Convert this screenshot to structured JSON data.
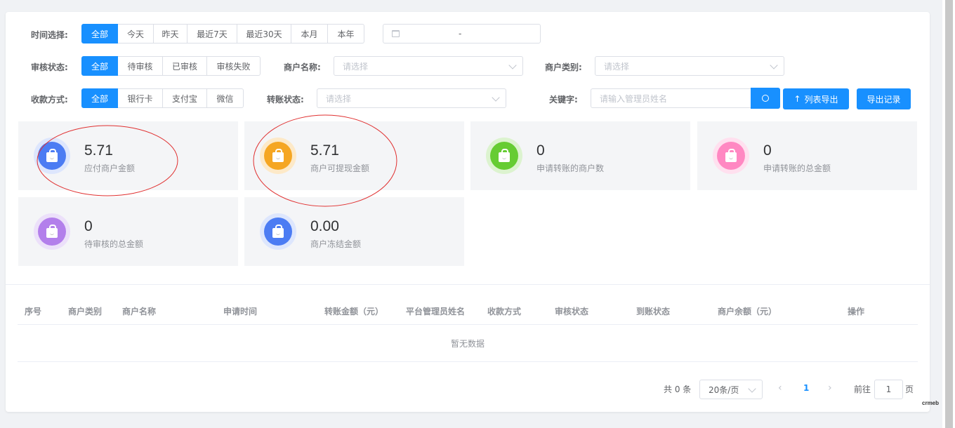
{
  "filters": {
    "time_label": "时间选择:",
    "time_options": [
      "全部",
      "今天",
      "昨天",
      "最近7天",
      "最近30天",
      "本月",
      "本年"
    ],
    "date_range_sep": "-",
    "audit_label": "审核状态:",
    "audit_options": [
      "全部",
      "待审核",
      "已审核",
      "审核失败"
    ],
    "merchant_name_label": "商户名称:",
    "merchant_name_placeholder": "请选择",
    "merchant_type_label": "商户类别:",
    "merchant_type_placeholder": "请选择",
    "pay_label": "收款方式:",
    "pay_options": [
      "全部",
      "银行卡",
      "支付宝",
      "微信"
    ],
    "transfer_label": "转账状态:",
    "transfer_placeholder": "请选择",
    "keyword_label": "关键字:",
    "keyword_placeholder": "请输入管理员姓名",
    "export_label": "列表导出",
    "export_record_label": "导出记录"
  },
  "stats": [
    {
      "value": "5.71",
      "label": "应付商户金额",
      "color": "#4c7cf3",
      "ring": "#dde6fd"
    },
    {
      "value": "5.71",
      "label": "商户可提现金额",
      "color": "#f5a623",
      "ring": "#fde9c8"
    },
    {
      "value": "0",
      "label": "申请转账的商户数",
      "color": "#66cc33",
      "ring": "#dcf3cf"
    },
    {
      "value": "0",
      "label": "申请转账的总金额",
      "color": "#ff88c2",
      "ring": "#ffe0ef"
    },
    {
      "value": "0",
      "label": "待审核的总金额",
      "color": "#b37feb",
      "ring": "#ece0fa"
    },
    {
      "value": "0.00",
      "label": "商户冻结金额",
      "color": "#4c7cf3",
      "ring": "#dde6fd"
    }
  ],
  "table": {
    "columns": [
      "序号",
      "商户类别",
      "商户名称",
      "申请时间",
      "转账金额（元）",
      "平台管理员姓名",
      "收款方式",
      "审核状态",
      "到账状态",
      "商户余额（元）",
      "操作"
    ],
    "empty_text": "暂无数据"
  },
  "pagination": {
    "total": "共 0 条",
    "page_size": "20条/页",
    "current_page": "1",
    "goto_label": "前往",
    "goto_value": "1",
    "page_unit": "页"
  },
  "watermark": "crmeb",
  "colors": {
    "primary": "#1890ff",
    "annotation": "#e03030"
  }
}
